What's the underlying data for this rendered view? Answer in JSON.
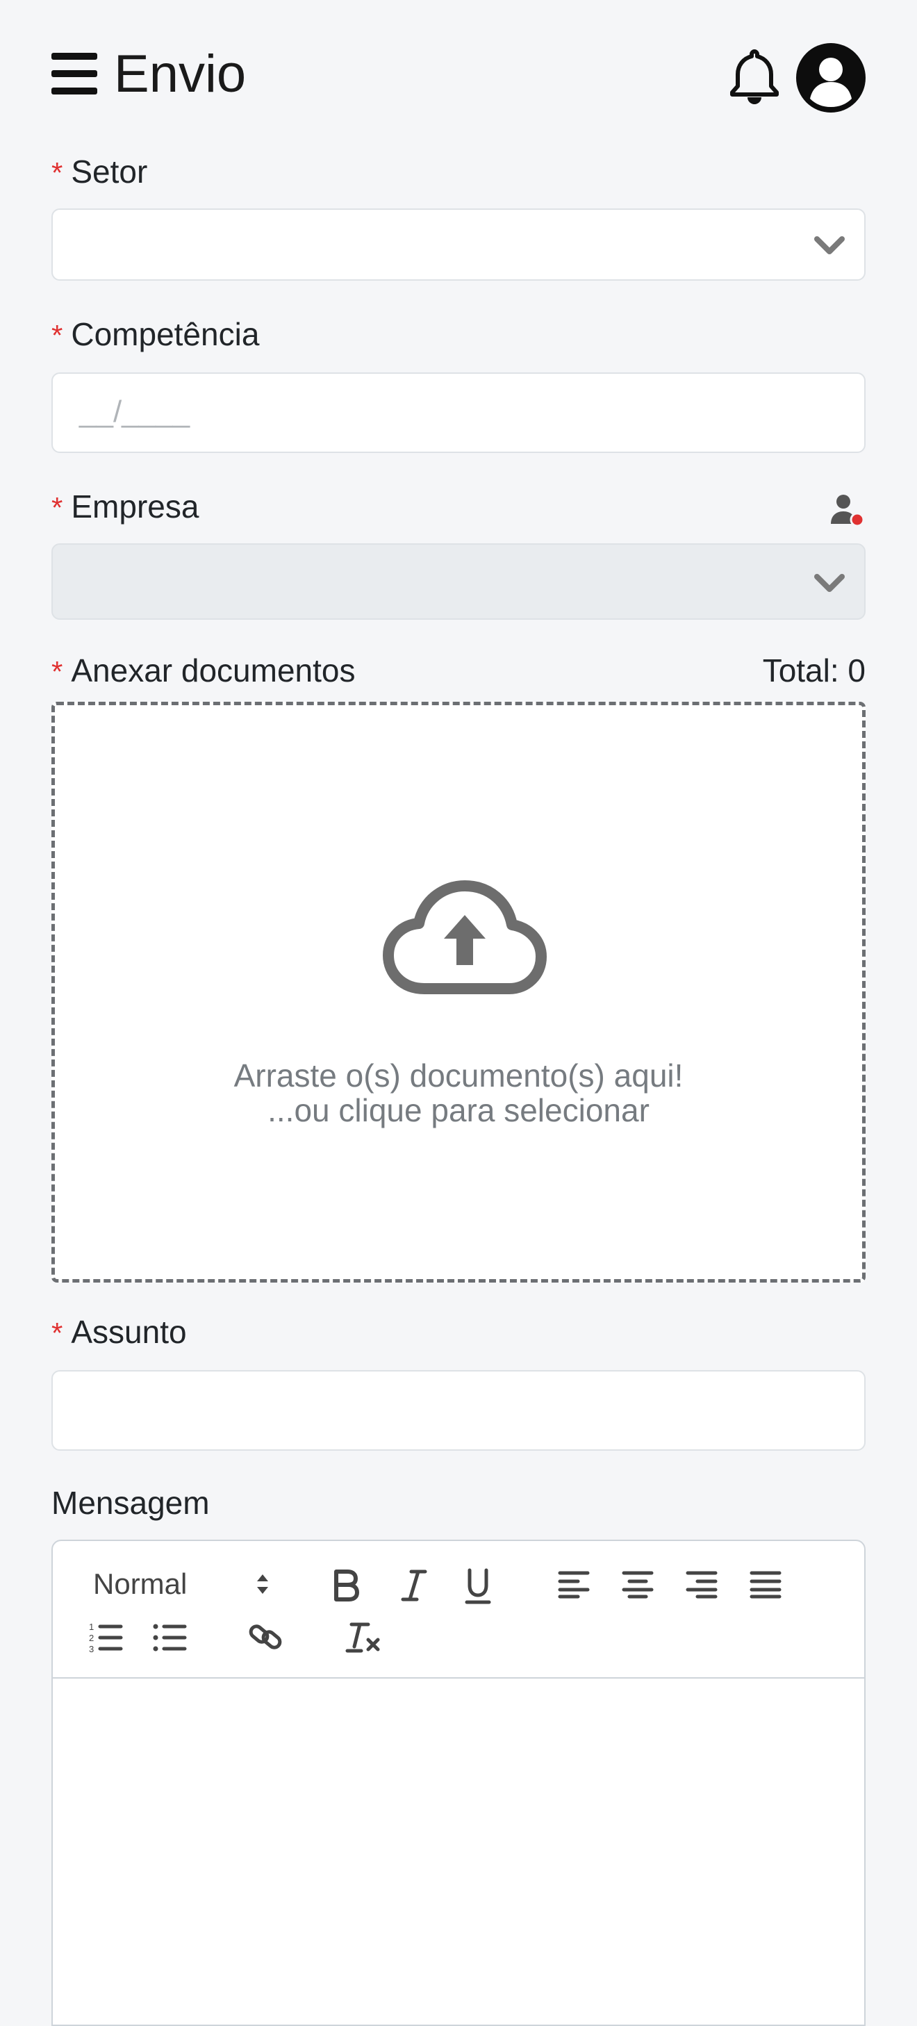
{
  "header": {
    "title": "Envio",
    "icons": {
      "menu": "hamburger-menu-icon",
      "notifications": "bell-icon",
      "profile": "user-avatar-icon"
    }
  },
  "form": {
    "required_mark": "*",
    "setor": {
      "label": "Setor",
      "value": ""
    },
    "competencia": {
      "label": "Competência",
      "placeholder": "__/____",
      "value": ""
    },
    "empresa": {
      "label": "Empresa",
      "value": "",
      "disabled": true,
      "status_icon": "user-with-red-dot-icon"
    },
    "anexos": {
      "label": "Anexar documentos",
      "total_text": "Total: 0",
      "dropzone_line1": "Arraste o(s) documento(s) aqui!",
      "dropzone_line2": "...ou clique para selecionar",
      "icon": "cloud-upload-icon"
    },
    "assunto": {
      "label": "Assunto",
      "value": ""
    },
    "mensagem": {
      "label": "Mensagem",
      "toolbar": {
        "format_select": "Normal",
        "buttons": [
          "bold",
          "italic",
          "underline",
          "align-left",
          "align-center",
          "align-right",
          "align-justify",
          "ordered-list",
          "bullet-list",
          "link",
          "clear-format"
        ]
      },
      "body": ""
    }
  },
  "colors": {
    "background": "#f5f6f8",
    "required": "#e03131",
    "status_dot": "#e03131",
    "dropzone_border": "#6c6f73",
    "icon_gray": "#6d6d6d"
  }
}
